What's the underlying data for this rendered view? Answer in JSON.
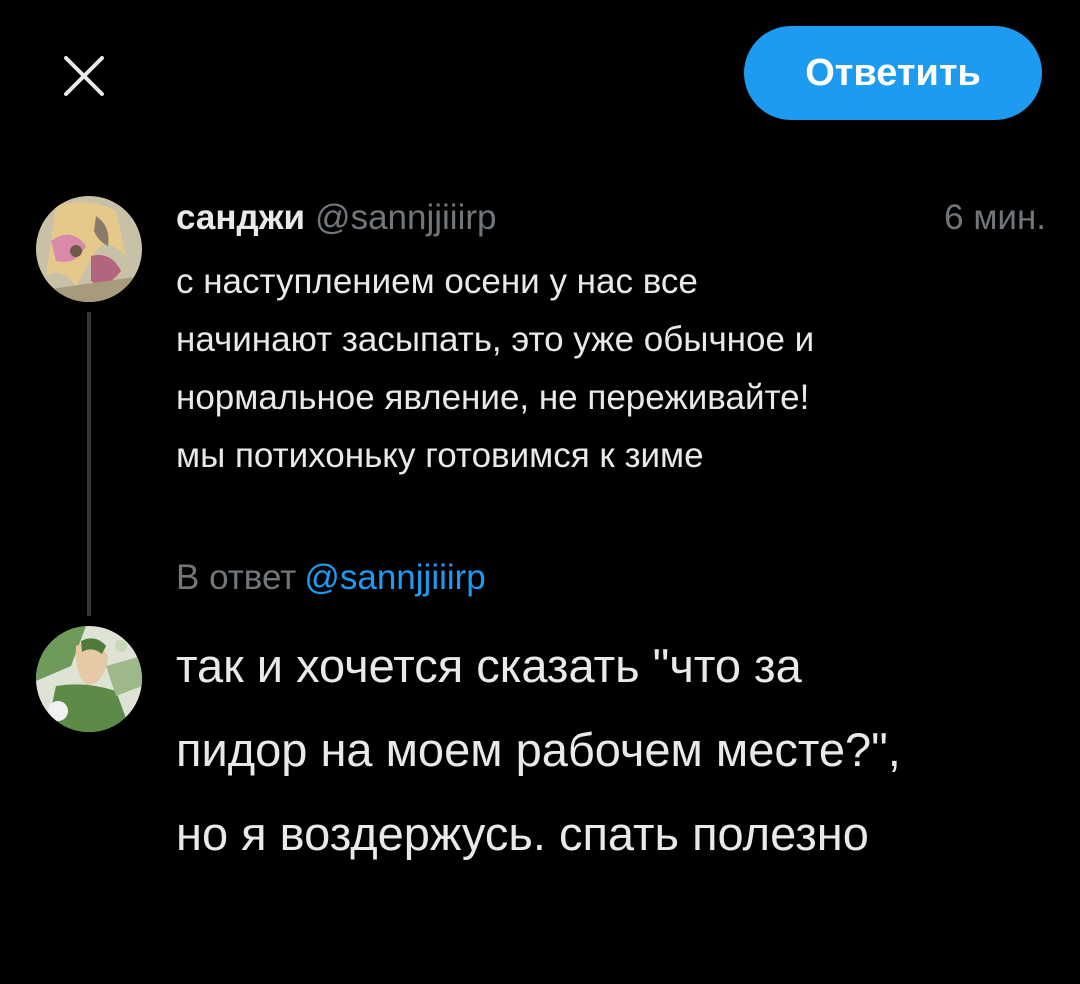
{
  "toolbar": {
    "close_icon": "close-icon",
    "reply_button_label": "Ответить",
    "accent_color": "#1d9bf0"
  },
  "original_tweet": {
    "author_name": "санджи",
    "author_handle": "@sannjjiiirp",
    "time": "6 мин.",
    "text": "с наступлением осени у нас все\nначинают засыпать, это уже обычное и\nнормальное явление, не переживайте!\nмы потихоньку готовимся к зиме",
    "avatar_icon": "avatar-image"
  },
  "reply": {
    "context_prefix": "В ответ",
    "context_mention": "@sannjjiiirp",
    "compose_text": "так и хочется сказать \"что за\nпидор на моем рабочем месте?\",\nно я воздержусь. спать полезно",
    "avatar_icon": "avatar-image"
  }
}
